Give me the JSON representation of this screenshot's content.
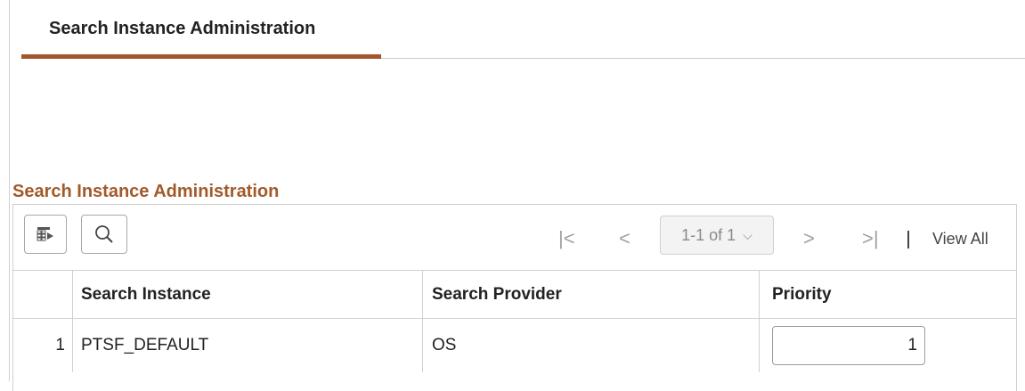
{
  "tabs": [
    {
      "label": "Search Instance Administration",
      "active": true
    }
  ],
  "section": {
    "title": "Search Instance Administration"
  },
  "grid": {
    "toolbar": {
      "personalize_icon": "grid-personalize-icon",
      "search_icon": "search-icon"
    },
    "pagination": {
      "first_glyph": "|<",
      "prev_glyph": "<",
      "range_label": "1-1 of 1",
      "dropdown_glyph": "⌵",
      "next_glyph": ">",
      "last_glyph": ">|",
      "view_all_label": "View All"
    },
    "columns": [
      "Search Instance",
      "Search Provider",
      "Priority"
    ],
    "rows": [
      {
        "num": "1",
        "search_instance": "PTSF_DEFAULT",
        "search_provider": "OS",
        "priority": "1"
      }
    ]
  },
  "colors": {
    "accent": "#a4552b",
    "section_title": "#a35a2a",
    "border": "#d0d0d0"
  }
}
